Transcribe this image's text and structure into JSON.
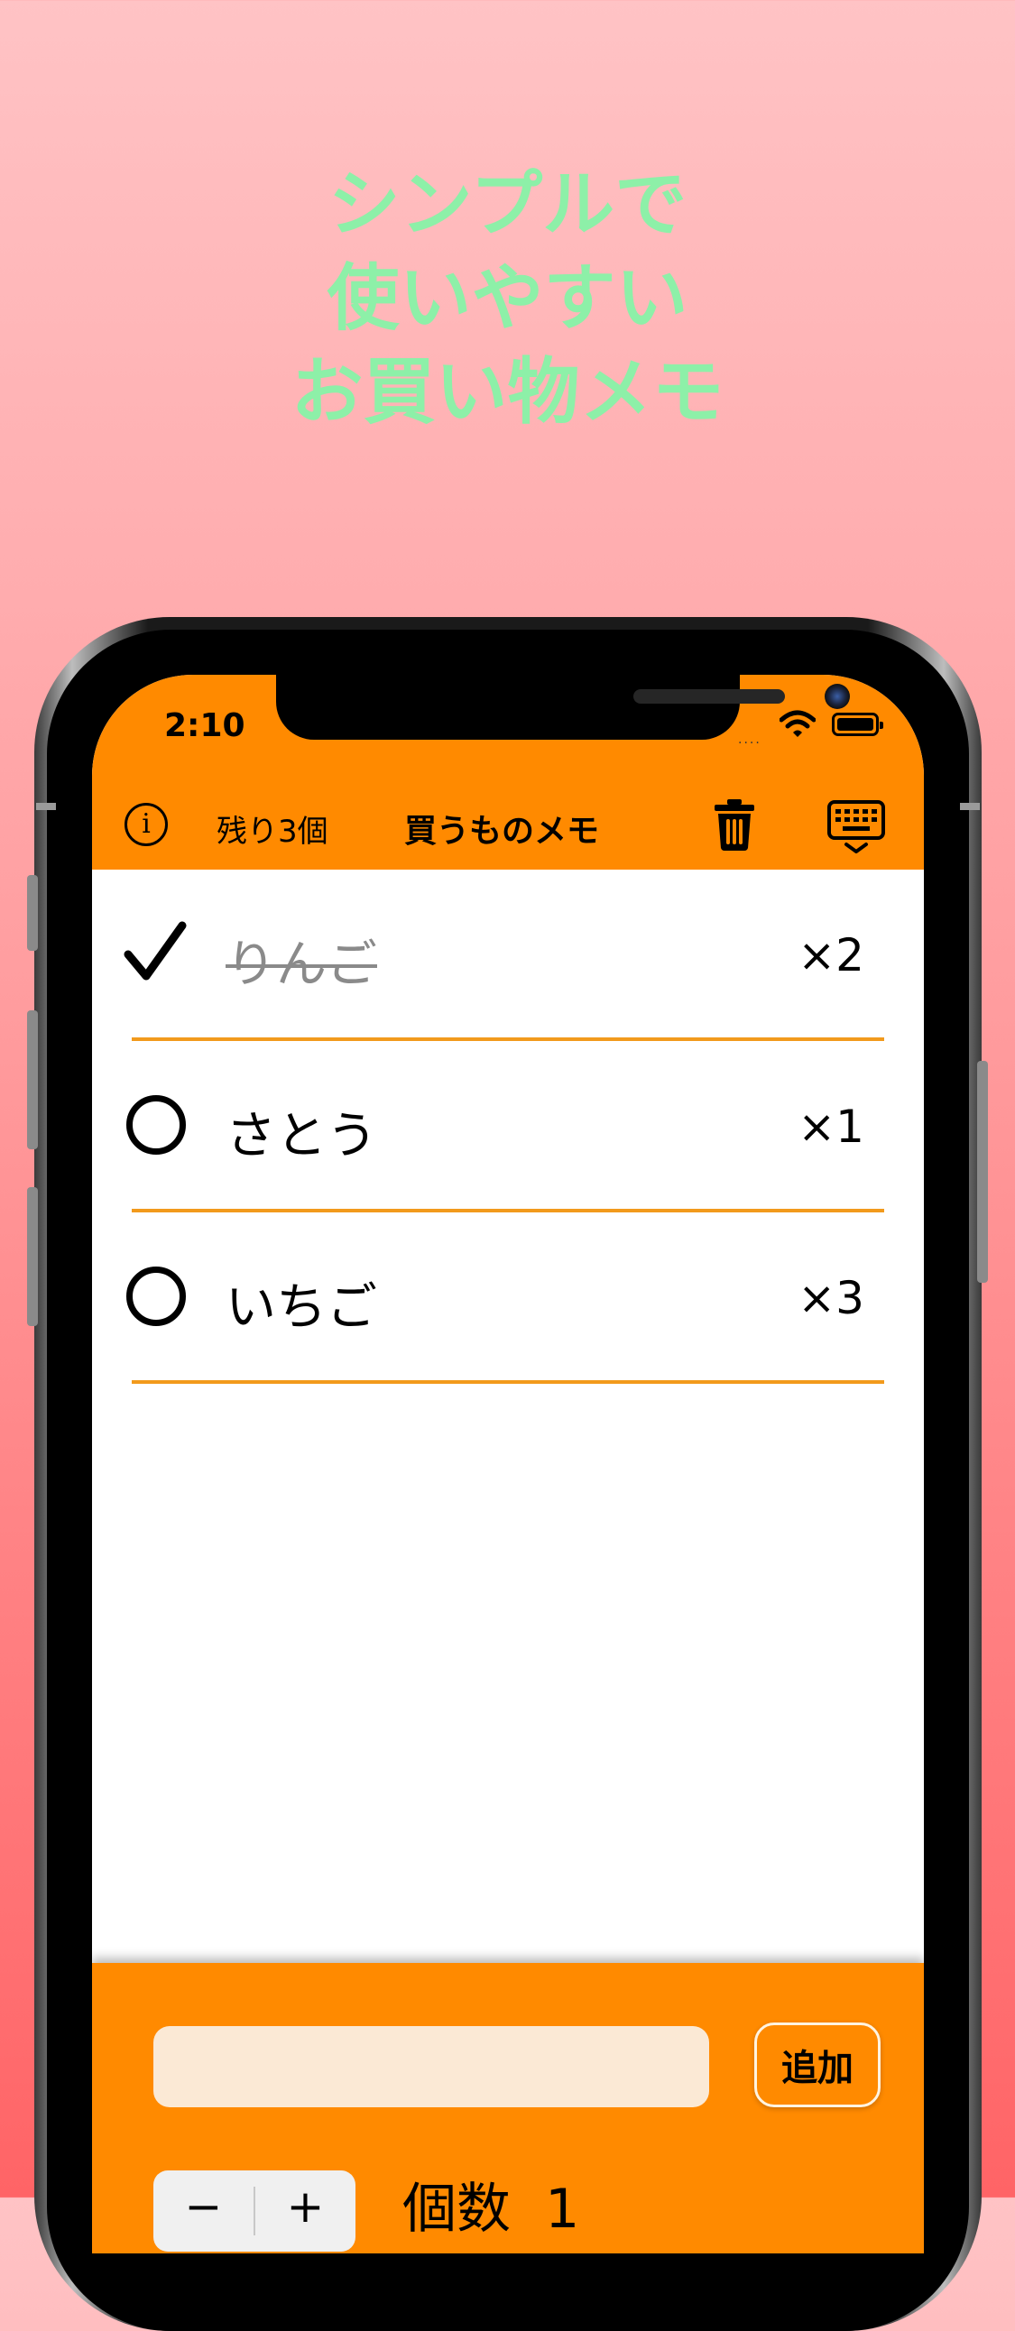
{
  "promo": {
    "lines": [
      "シンプルで",
      "使いやすい",
      "お買い物メモ"
    ]
  },
  "status_bar": {
    "time": "2:10",
    "signal": "....",
    "wifi_icon": "wifi-icon",
    "battery_icon": "battery-icon"
  },
  "navbar": {
    "info_icon": "info-icon",
    "info_glyph": "i",
    "remaining": "残り3個",
    "title": "買うものメモ",
    "trash_icon": "trash-icon",
    "keyboard_icon": "keyboard-dismiss-icon"
  },
  "items": [
    {
      "name": "りんご",
      "qty": "×2",
      "checked": true
    },
    {
      "name": "さとう",
      "qty": "×1",
      "checked": false
    },
    {
      "name": "いちご",
      "qty": "×3",
      "checked": false
    }
  ],
  "input_panel": {
    "item_value": "",
    "item_placeholder": "",
    "add_label": "追加",
    "stepper_minus": "−",
    "stepper_plus": "+",
    "count_label": "個数",
    "count_value": "1"
  },
  "colors": {
    "accent": "#ff8a00",
    "divider": "#f29a1c",
    "promo_text": "#8df0a8"
  }
}
